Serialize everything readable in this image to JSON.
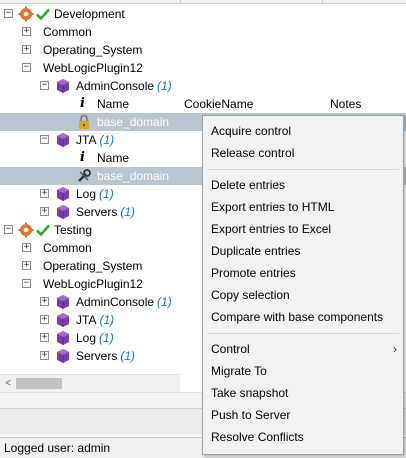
{
  "tree": {
    "env1": {
      "label": "Development"
    },
    "common1": {
      "label": "Common"
    },
    "os1": {
      "label": "Operating_System"
    },
    "wlp1": {
      "label": "WebLogicPlugin12"
    },
    "admin1": {
      "label": "AdminConsole",
      "count": "(1)"
    },
    "table1": {
      "col_name": "Name",
      "col_cookie": "CookieName",
      "col_notes": "Notes"
    },
    "domain1": {
      "label": "base_domain"
    },
    "jta1": {
      "label": "JTA",
      "count": "(1)"
    },
    "jta_table": {
      "col_name": "Name"
    },
    "domain2": {
      "label": "base_domain"
    },
    "log1": {
      "label": "Log",
      "count": "(1)"
    },
    "servers1": {
      "label": "Servers",
      "count": "(1)"
    },
    "env2": {
      "label": "Testing"
    },
    "common2": {
      "label": "Common"
    },
    "os2": {
      "label": "Operating_System"
    },
    "wlp2": {
      "label": "WebLogicPlugin12"
    },
    "admin2": {
      "label": "AdminConsole",
      "count": "(1)"
    },
    "jta2": {
      "label": "JTA",
      "count": "(1)"
    },
    "log2": {
      "label": "Log",
      "count": "(1)"
    },
    "servers2": {
      "label": "Servers",
      "count": "(1)"
    }
  },
  "expand_symbols": {
    "collapse": "−",
    "expand": "+"
  },
  "scrollbar": {
    "left_arrow": "<"
  },
  "status": {
    "text": "Logged user: admin"
  },
  "context_menu": {
    "acquire": "Acquire control",
    "release": "Release control",
    "delete": "Delete entries",
    "export_html": "Export entries to HTML",
    "export_excel": "Export entries to Excel",
    "duplicate": "Duplicate entries",
    "promote": "Promote entries",
    "copy": "Copy selection",
    "compare": "Compare with base components",
    "control": "Control",
    "control_arrow": "›",
    "migrate": "Migrate To",
    "snapshot": "Take snapshot",
    "push": "Push to Server",
    "resolve": "Resolve Conflicts"
  },
  "colors": {
    "selection": "#b9c6cf",
    "count_text": "#1f73b7",
    "check": "#2fa531",
    "gear": "#e0752d",
    "cube": "#7a3fa8"
  },
  "icons": {
    "environment": "gear-icon",
    "status": "check-icon",
    "component": "cube-icon",
    "info": "info-icon",
    "lock": "lock-icon",
    "tools": "wrench-icon"
  }
}
